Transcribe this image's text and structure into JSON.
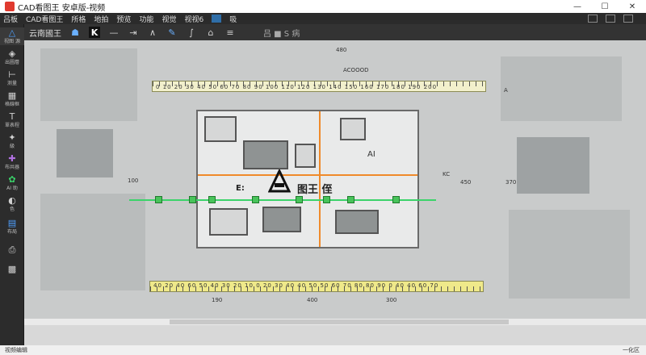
{
  "window": {
    "title": "CAD看图王 安卓版-视频",
    "minimize": "—",
    "maximize": "☐",
    "close": "✕"
  },
  "menu": {
    "items": [
      "吕板",
      "CAD看图王",
      "所格",
      "地拍",
      "预览",
      "功能",
      "视觉",
      "视视6"
    ],
    "right_tab": "吸"
  },
  "toolbar": {
    "label": "云南國王",
    "right_text": "吕 ■ S 病"
  },
  "sidebar": {
    "items": [
      {
        "icon": "triangle-icon",
        "glyph": "△",
        "label": "视图 源"
      },
      {
        "icon": "layers-icon",
        "glyph": "◈",
        "label": "出圖層"
      },
      {
        "icon": "ruler-icon",
        "glyph": "⊢",
        "label": "测量"
      },
      {
        "icon": "grid-icon",
        "glyph": "▦",
        "label": "格線框"
      },
      {
        "icon": "text-icon",
        "glyph": "T",
        "label": "單表程"
      },
      {
        "icon": "star-icon",
        "glyph": "✦",
        "label": "級"
      },
      {
        "icon": "share-icon",
        "glyph": "✚",
        "label": "布共器"
      },
      {
        "icon": "plugin-icon",
        "glyph": "✿",
        "label": "AI 助"
      },
      {
        "icon": "palette-icon",
        "glyph": "◐",
        "label": "色"
      },
      {
        "icon": "layout-icon",
        "glyph": "▤",
        "label": "布局"
      },
      {
        "icon": "print-icon",
        "glyph": "⎙",
        "label": ""
      },
      {
        "icon": "qr-icon",
        "glyph": "▩",
        "label": ""
      }
    ]
  },
  "canvas": {
    "top_ruler_text": "0 10 20 30 40 50 60 70 80 90 100 110 120 130 140 150 160 170 180 190 200",
    "bottom_ruler_text": "40 20 40 60 50 40 30 20 10 0 20 30 40 40 50 50 60 70 80 80 90 0 40 40 60 70",
    "dim_top": "480",
    "dim_top_right": "ACOOOD",
    "dim_left": "100",
    "dim_bottom_left": "190",
    "dim_bottom_mid": "400",
    "dim_bottom_right": "300",
    "dim_right_a": "KC",
    "dim_right_b": "450",
    "dim_right_c": "370",
    "dim_right_d": "A",
    "plan_ai": "AI",
    "plan_title_left": "E:",
    "plan_title": "图王 侄"
  },
  "status": {
    "left": "视频编辑",
    "right": "一化区"
  },
  "colors": {
    "accent": "#4fa0ff",
    "green": "#3bd36a",
    "orange": "#f08a2a",
    "ruler_yellow": "#efe98a"
  }
}
